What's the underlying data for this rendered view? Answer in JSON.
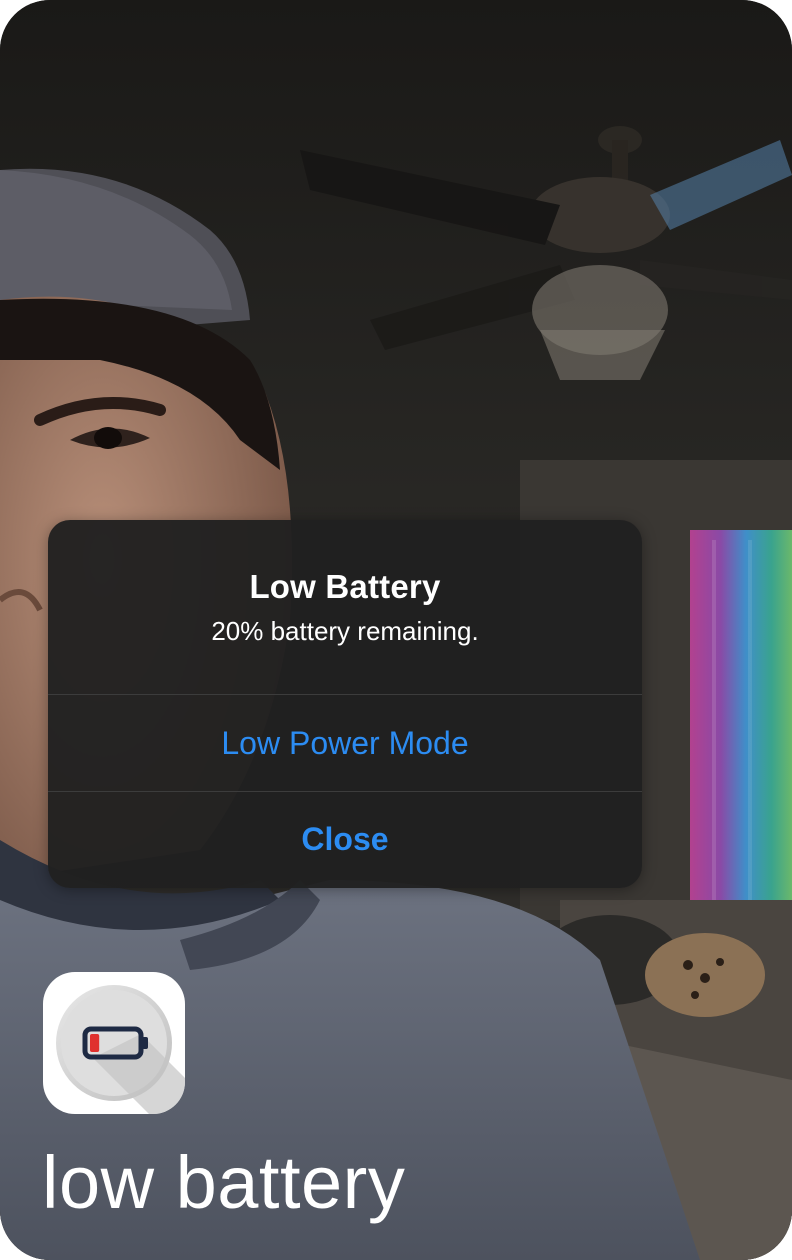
{
  "alert": {
    "title": "Low Battery",
    "message": "20% battery remaining.",
    "low_power_button": "Low Power Mode",
    "close_button": "Close"
  },
  "app": {
    "icon": "battery-low-icon",
    "battery_level": 0.2
  },
  "caption": {
    "text": "low battery"
  },
  "colors": {
    "alert_background": "#202020",
    "button_text": "#2c8cf2",
    "battery_red": "#e0312e",
    "battery_outline": "#1e2a44"
  }
}
